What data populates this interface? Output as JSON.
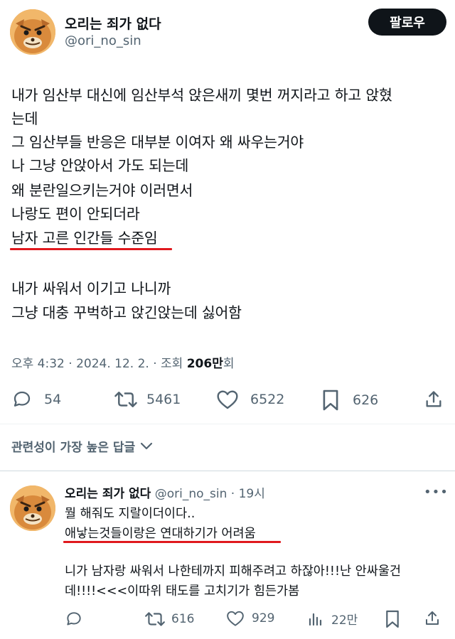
{
  "tweet": {
    "author": {
      "display_name": "오리는 죄가 없다",
      "handle": "@ori_no_sin"
    },
    "follow_label": "팔로우",
    "lines": [
      "내가 임산부 대신에 임산부석 앉은새끼 몇번 꺼지라고 하고 앉혔",
      "는데",
      "그 임산부들 반응은 대부분 이여자 왜 싸우는거야",
      "나 그냥 안앉아서 가도 되는데",
      "왜 분란일으키는거야 이러면서",
      "나랑도 편이 안되더라",
      "남자 고른 인간들 수준임",
      "내가 싸워서 이기고 나니까",
      "그냥 대충 꾸벅하고 앉긴앉는데 싫어함"
    ],
    "meta": {
      "time": "오후 4:32",
      "date": "2024. 12. 2.",
      "views_label": "조회",
      "views_value": "206만",
      "views_suffix": "회"
    },
    "actions": {
      "replies": "54",
      "retweets": "5461",
      "likes": "6522",
      "bookmarks": "626"
    }
  },
  "relevance_label": "관련성이 가장 높은 답글",
  "reply": {
    "author": {
      "display_name": "오리는 죄가 없다",
      "handle": "@ori_no_sin",
      "time": "19시"
    },
    "lines": [
      "뭘 해줘도 지랄이더이다..",
      "애낳는것들이랑은 연대하기가 어려움",
      "니가 남자랑 싸워서 나한테까지 피해주려고 하잖아!!!난 안싸울건",
      "데!!!!<<<이따위 태도를 고치기가 힘든가봄"
    ],
    "actions": {
      "retweets": "616",
      "likes": "929",
      "views": "22만"
    }
  },
  "colors": {
    "underline": "#e0191e",
    "text": "#0f1419",
    "secondary": "#536471",
    "avatar": "#e8a352"
  }
}
